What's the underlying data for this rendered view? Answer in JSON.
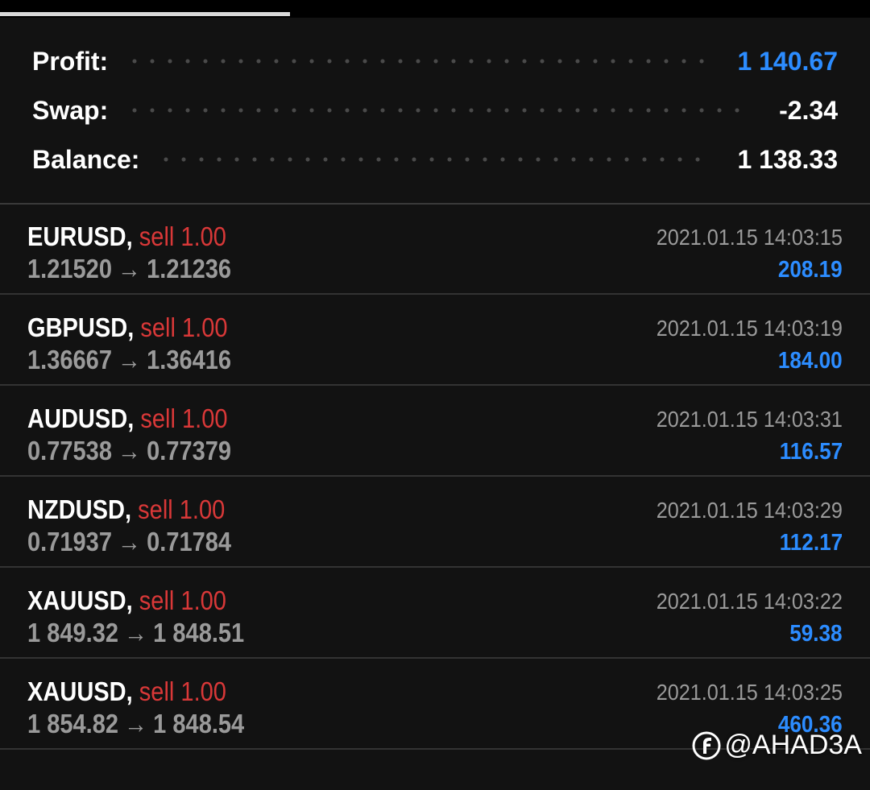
{
  "summary": {
    "profit_label": "Profit:",
    "profit_value": "1 140.67",
    "swap_label": "Swap:",
    "swap_value": "-2.34",
    "balance_label": "Balance:",
    "balance_value": "1 138.33",
    "colors": {
      "positive": "#2c8cff",
      "neutral": "#ffffff"
    }
  },
  "trades": [
    {
      "symbol": "EURUSD,",
      "side": "sell 1.00",
      "open": "1.21520",
      "arrow": "→",
      "close": "1.21236",
      "time": "2021.01.15 14:03:15",
      "profit": "208.19"
    },
    {
      "symbol": "GBPUSD,",
      "side": "sell 1.00",
      "open": "1.36667",
      "arrow": "→",
      "close": "1.36416",
      "time": "2021.01.15 14:03:19",
      "profit": "184.00"
    },
    {
      "symbol": "AUDUSD,",
      "side": "sell 1.00",
      "open": "0.77538",
      "arrow": "→",
      "close": "0.77379",
      "time": "2021.01.15 14:03:31",
      "profit": "116.57"
    },
    {
      "symbol": "NZDUSD,",
      "side": "sell 1.00",
      "open": "0.71937",
      "arrow": "→",
      "close": "0.71784",
      "time": "2021.01.15 14:03:29",
      "profit": "112.17"
    },
    {
      "symbol": "XAUUSD,",
      "side": "sell 1.00",
      "open": "1 849.32",
      "arrow": "→",
      "close": "1 848.51",
      "time": "2021.01.15 14:03:22",
      "profit": "59.38"
    },
    {
      "symbol": "XAUUSD,",
      "side": "sell 1.00",
      "open": "1 854.82",
      "arrow": "→",
      "close": "1 848.54",
      "time": "2021.01.15 14:03:25",
      "profit": "460.36"
    }
  ],
  "colors": {
    "sell": "#d93838",
    "profit": "#2c8cff",
    "muted": "#9a9a9a"
  },
  "watermark": {
    "text": "@AHAD3A",
    "icon": "brand-logo-icon"
  }
}
